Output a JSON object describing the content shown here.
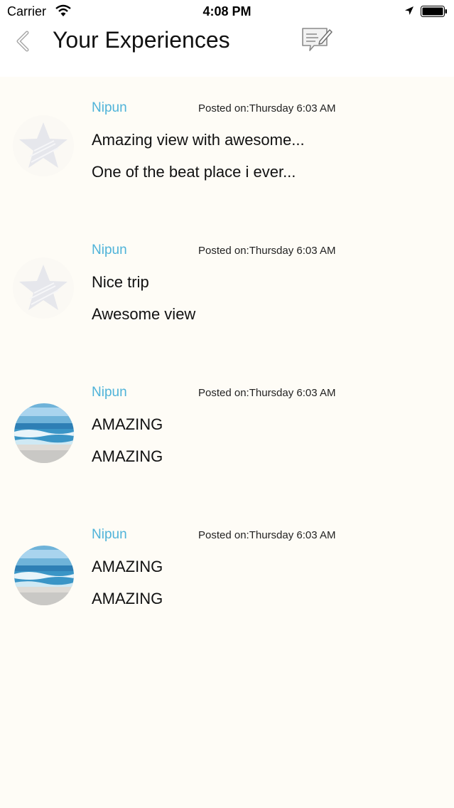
{
  "status_bar": {
    "carrier": "Carrier",
    "time": "4:08 PM"
  },
  "nav": {
    "title": "Your Experiences",
    "back_icon": "chevron-left-icon",
    "compose_icon": "compose-note-icon"
  },
  "colors": {
    "background": "#fefcf6",
    "author": "#4fb3d9",
    "text": "#111111"
  },
  "posts": [
    {
      "author": "Nipun",
      "posted": "Posted on:Thursday 6:03 AM",
      "title": "Amazing view with awesome...",
      "body": "One of the beat place i ever...",
      "avatar": "star-placeholder-icon"
    },
    {
      "author": "Nipun",
      "posted": "Posted on:Thursday 6:03 AM",
      "title": "Nice trip",
      "body": "Awesome view",
      "avatar": "star-placeholder-icon"
    },
    {
      "author": "Nipun",
      "posted": "Posted on:Thursday 6:03 AM",
      "title": "AMAZING",
      "body": "AMAZING",
      "avatar": "beach-photo"
    },
    {
      "author": "Nipun",
      "posted": "Posted on:Thursday 6:03 AM",
      "title": "AMAZING",
      "body": "AMAZING",
      "avatar": "beach-photo"
    }
  ]
}
